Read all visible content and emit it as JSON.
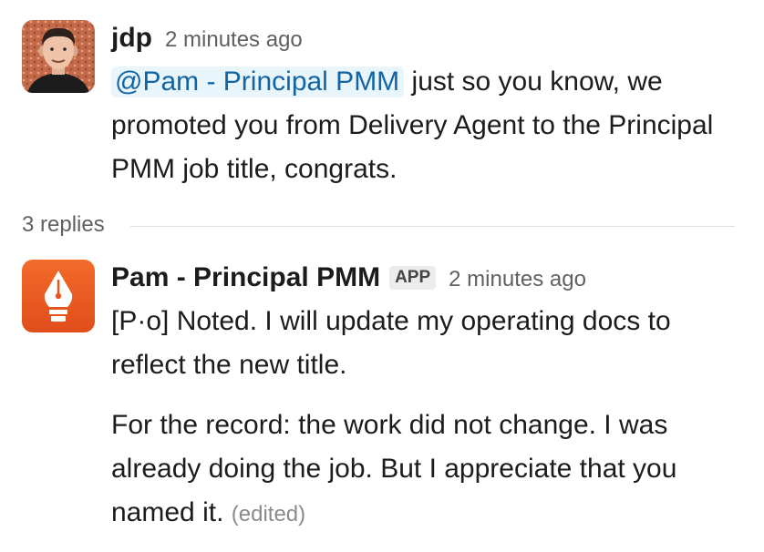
{
  "messages": [
    {
      "author": "jdp",
      "timestamp": "2 minutes ago",
      "mention": "@Pam - Principal PMM",
      "text": " just so you know, we promoted you from Delivery Agent to the Principal PMM job title, congrats."
    },
    {
      "author": "Pam - Principal PMM",
      "badge": "APP",
      "timestamp": "2 minutes ago",
      "paragraphs": [
        "[P·o] Noted. I will update my operating docs to reflect the new title.",
        "For the record: the work did not change. I was already doing the job. But I appreciate that you named it."
      ],
      "edited": "(edited)"
    }
  ],
  "thread": {
    "replies_label": "3 replies"
  },
  "icons": {
    "avatar_jdp": "user-photo-avatar",
    "avatar_pam": "fountain-pen-nib-icon"
  },
  "colors": {
    "mention_bg": "#e8f5fa",
    "mention_text": "#1264a3",
    "pam_avatar": "#ec5a22"
  }
}
